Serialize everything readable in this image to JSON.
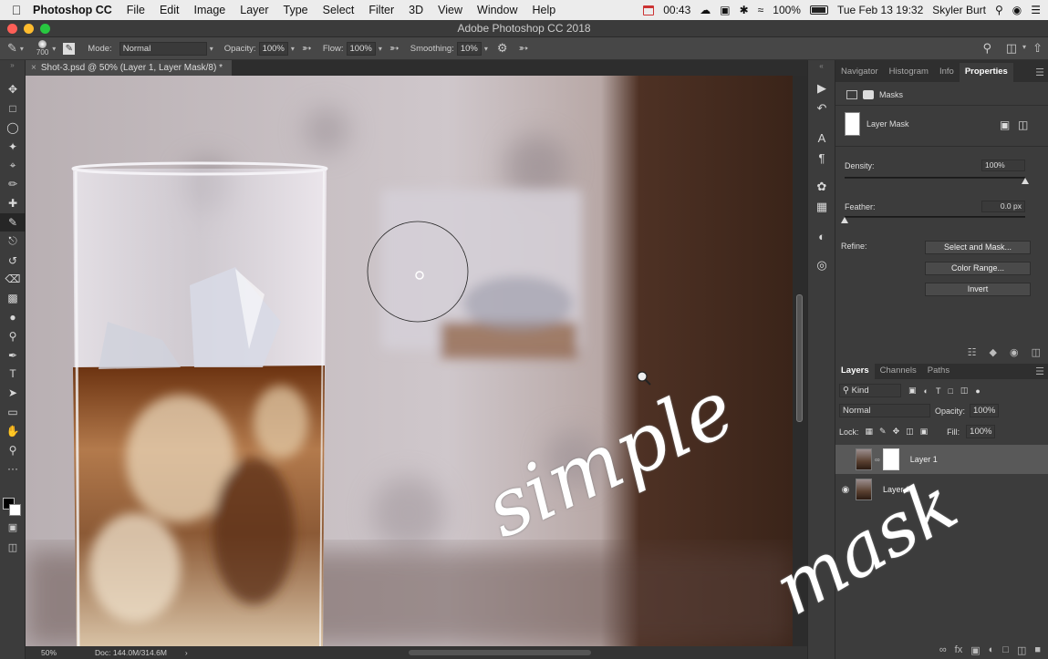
{
  "menubar": {
    "app_name": "Photoshop CC",
    "items": [
      "File",
      "Edit",
      "Image",
      "Layer",
      "Type",
      "Select",
      "Filter",
      "3D",
      "View",
      "Window",
      "Help"
    ],
    "clock_timer": "00:43",
    "battery": "100%",
    "datetime": "Tue Feb 13  19:32",
    "user": "Skyler Burt"
  },
  "window": {
    "title": "Adobe Photoshop CC 2018"
  },
  "options": {
    "brush_size": "700",
    "mode_label": "Mode:",
    "mode_value": "Normal",
    "opacity_label": "Opacity:",
    "opacity_value": "100%",
    "flow_label": "Flow:",
    "flow_value": "100%",
    "smoothing_label": "Smoothing:",
    "smoothing_value": "10%"
  },
  "document": {
    "tab_title": "Shot-3.psd @ 50% (Layer 1, Layer Mask/8) *",
    "zoom": "50%",
    "doc_info": "Doc: 144.0M/314.6M"
  },
  "overlay": {
    "word1": "simple",
    "word2": "mask"
  },
  "properties_panel": {
    "tabs": [
      "Navigator",
      "Histogram",
      "Info",
      "Properties"
    ],
    "active_tab": "Properties",
    "section": "Masks",
    "mask_name": "Layer Mask",
    "density_label": "Density:",
    "density_value": "100%",
    "density": 1.0,
    "feather_label": "Feather:",
    "feather_value": "0.0 px",
    "feather": 0.0,
    "refine_label": "Refine:",
    "select_and_mask": "Select and Mask...",
    "color_range": "Color Range...",
    "invert": "Invert"
  },
  "layers_panel": {
    "tabs": [
      "Layers",
      "Channels",
      "Paths"
    ],
    "active_tab": "Layers",
    "filter_kind": "Kind",
    "blend_mode": "Normal",
    "opacity_label": "Opacity:",
    "opacity_value": "100%",
    "lock_label": "Lock:",
    "fill_label": "Fill:",
    "fill_value": "100%",
    "layers": [
      {
        "name": "Layer 1",
        "visible": false,
        "has_mask": true,
        "selected": true
      },
      {
        "name": "Layer 0",
        "visible": true,
        "has_mask": false,
        "selected": false
      }
    ]
  }
}
